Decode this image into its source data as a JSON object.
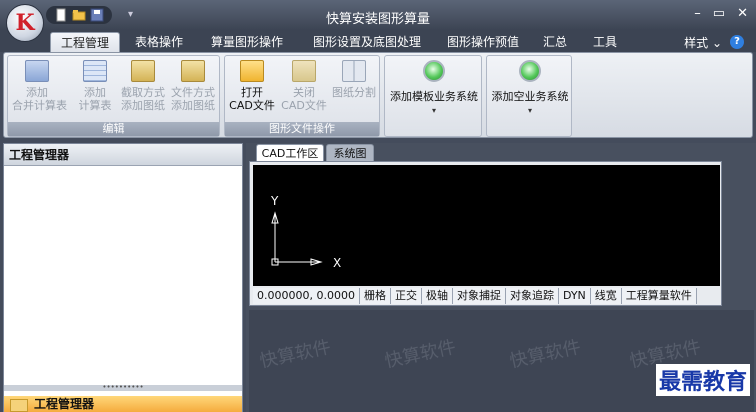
{
  "app": {
    "title": "快算安装图形算量",
    "logo_letter": "K"
  },
  "window_controls": {
    "minimize": "–",
    "restore": "▭",
    "close": "✕"
  },
  "quick_access": {
    "icons": [
      "new-file-icon",
      "open-folder-icon",
      "save-icon"
    ],
    "dropdown": "▾"
  },
  "tabs": [
    "工程管理",
    "表格操作",
    "算量图形操作",
    "图形设置及底图处理",
    "图形操作预值",
    "汇总",
    "工具"
  ],
  "active_tab": "工程管理",
  "style_menu": {
    "label": "样式 ⌄",
    "help": "?"
  },
  "ribbon": {
    "group_edit": {
      "label": "编辑",
      "buttons": [
        {
          "l1": "添加",
          "l2": "合并计算表",
          "enabled": false
        },
        {
          "l1": "添加",
          "l2": "计算表",
          "enabled": false
        },
        {
          "l1": "截取方式",
          "l2": "添加图纸",
          "enabled": false
        },
        {
          "l1": "文件方式",
          "l2": "添加图纸",
          "enabled": false
        }
      ]
    },
    "group_file": {
      "label": "图形文件操作",
      "buttons": [
        {
          "l1": "打开",
          "l2": "CAD文件",
          "enabled": true
        },
        {
          "l1": "关闭",
          "l2": "CAD文件",
          "enabled": false
        },
        {
          "l1": "图纸分割",
          "l2": "",
          "enabled": false
        }
      ]
    },
    "template_btn": {
      "label": "添加模板业务系统",
      "arrow": "▾"
    },
    "empty_btn": {
      "label": "添加空业务系统",
      "arrow": "▾"
    }
  },
  "left_panel": {
    "title": "工程管理器",
    "footer": "工程管理器",
    "splitter": "••••••••••"
  },
  "view_tabs": [
    "CAD工作区",
    "系统图"
  ],
  "active_view": "CAD工作区",
  "cad": {
    "axis_y": "Y",
    "axis_x": "X"
  },
  "statusbar": [
    "0.000000,  0.0000",
    "栅格",
    "正交",
    "极轴",
    "对象捕捉",
    "对象追踪",
    "DYN",
    "线宽",
    "工程算量软件"
  ],
  "watermark": "快算软件",
  "brand_overlay": "最需教育",
  "colors": {
    "accent": "#f4a93a",
    "brand": "#1838a8",
    "titlebar": "#3c4453"
  }
}
